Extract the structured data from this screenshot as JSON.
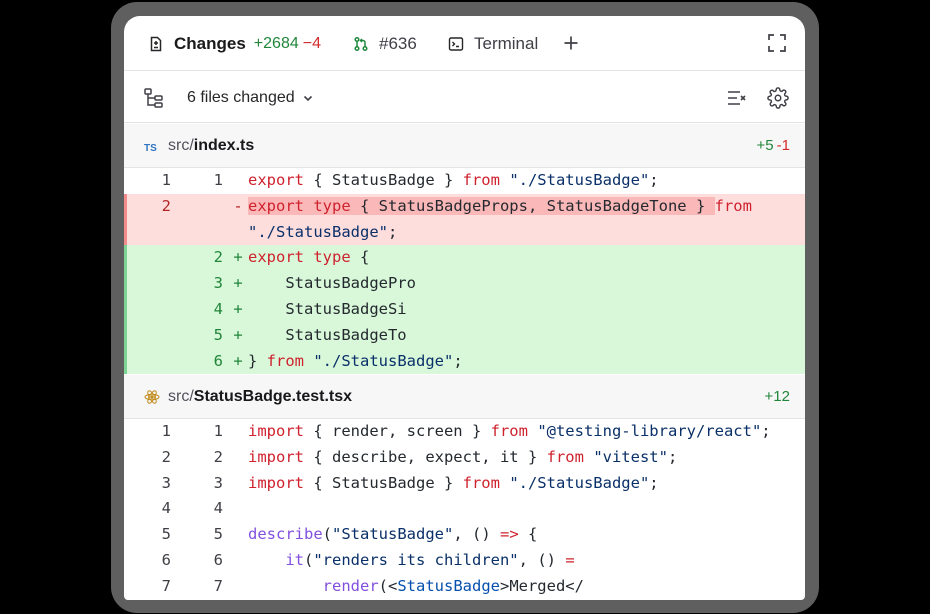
{
  "top_bar": {
    "changes_label": "Changes",
    "changes_additions": "+2684",
    "changes_deletions": "−4",
    "pr_label": "#636",
    "terminal_label": "Terminal",
    "icons": [
      "file-diff-icon",
      "pull-request-icon",
      "terminal-icon",
      "plus-icon",
      "expand-icon"
    ]
  },
  "toolbar": {
    "files_changed_label": "6 files changed",
    "icons": [
      "file-tree-icon",
      "chevron-down-icon",
      "collapse-all-icon",
      "gear-icon"
    ]
  },
  "files": [
    {
      "type_badge": "TS",
      "path_dir": "src/",
      "path_name": "index.ts",
      "additions": "+5",
      "deletions": "-1",
      "lines": [
        {
          "old": "1",
          "new": "1",
          "marker": "",
          "kind": "ctx",
          "code": [
            [
              "kw",
              "export"
            ],
            [
              "",
              " { StatusBadge } "
            ],
            [
              "kw",
              "from"
            ],
            [
              "",
              " "
            ],
            [
              "str",
              "\"./StatusBadge\""
            ],
            [
              "",
              ";"
            ]
          ]
        },
        {
          "old": "2",
          "new": "",
          "marker": "-",
          "kind": "del",
          "code": [
            [
              "kw hl",
              "export"
            ],
            [
              "hl",
              " "
            ],
            [
              "kw hl",
              "type"
            ],
            [
              "hl",
              " { StatusBadgeProps, StatusBadgeTone } "
            ],
            [
              "kw",
              "from"
            ]
          ]
        },
        {
          "old": "",
          "new": "",
          "marker": "",
          "kind": "del",
          "code": [
            [
              "str",
              "\"./StatusBadge\""
            ],
            [
              "",
              ";"
            ]
          ]
        },
        {
          "old": "",
          "new": "2",
          "marker": "+",
          "kind": "add",
          "code": [
            [
              "kw",
              "export"
            ],
            [
              "",
              " "
            ],
            [
              "kw",
              "type"
            ],
            [
              "",
              " {"
            ]
          ]
        },
        {
          "old": "",
          "new": "3",
          "marker": "+",
          "kind": "add",
          "code": [
            [
              "",
              "    StatusBadgePro"
            ]
          ]
        },
        {
          "old": "",
          "new": "4",
          "marker": "+",
          "kind": "add",
          "code": [
            [
              "",
              "    StatusBadgeSi"
            ]
          ]
        },
        {
          "old": "",
          "new": "5",
          "marker": "+",
          "kind": "add",
          "code": [
            [
              "",
              "    StatusBadgeTo"
            ]
          ]
        },
        {
          "old": "",
          "new": "6",
          "marker": "+",
          "kind": "add",
          "code": [
            [
              "",
              "} "
            ],
            [
              "kw",
              "from"
            ],
            [
              "",
              " "
            ],
            [
              "str",
              "\"./StatusBadge\""
            ],
            [
              "",
              ";"
            ]
          ]
        }
      ]
    },
    {
      "type_badge": "",
      "path_dir": "src/",
      "path_name": "StatusBadge.test.tsx",
      "additions": "+12",
      "deletions": "",
      "lines": [
        {
          "old": "1",
          "new": "1",
          "marker": "",
          "kind": "ctx",
          "code": [
            [
              "kw",
              "import"
            ],
            [
              "",
              " { render, screen } "
            ],
            [
              "kw",
              "from"
            ],
            [
              "",
              " "
            ],
            [
              "str",
              "\"@testing-library/react\""
            ],
            [
              "",
              ";"
            ]
          ]
        },
        {
          "old": "2",
          "new": "2",
          "marker": "",
          "kind": "ctx",
          "code": [
            [
              "kw",
              "import"
            ],
            [
              "",
              " { describe, expect, it } "
            ],
            [
              "kw",
              "from"
            ],
            [
              "",
              " "
            ],
            [
              "str",
              "\"vitest\""
            ],
            [
              "",
              ";"
            ]
          ]
        },
        {
          "old": "3",
          "new": "3",
          "marker": "",
          "kind": "ctx",
          "code": [
            [
              "kw",
              "import"
            ],
            [
              "",
              " { StatusBadge } "
            ],
            [
              "kw",
              "from"
            ],
            [
              "",
              " "
            ],
            [
              "str",
              "\"./StatusBadge\""
            ],
            [
              "",
              ";"
            ]
          ]
        },
        {
          "old": "4",
          "new": "4",
          "marker": "",
          "kind": "ctx",
          "code": []
        },
        {
          "old": "5",
          "new": "5",
          "marker": "",
          "kind": "ctx",
          "code": [
            [
              "fn",
              "describe"
            ],
            [
              "",
              "("
            ],
            [
              "str",
              "\"StatusBadge\""
            ],
            [
              "",
              ", () "
            ],
            [
              "kw",
              "=>"
            ],
            [
              "",
              " {"
            ]
          ]
        },
        {
          "old": "6",
          "new": "6",
          "marker": "",
          "kind": "ctx",
          "code": [
            [
              "",
              "    "
            ],
            [
              "fn",
              "it"
            ],
            [
              "",
              "("
            ],
            [
              "str",
              "\"renders its children\""
            ],
            [
              "",
              ", () "
            ],
            [
              "kw",
              "="
            ]
          ]
        },
        {
          "old": "7",
          "new": "7",
          "marker": "",
          "kind": "ctx",
          "code": [
            [
              "",
              "        "
            ],
            [
              "fn",
              "render"
            ],
            [
              "",
              "(<"
            ],
            [
              "cmp",
              "StatusBadge"
            ],
            [
              "",
              ">Merged</"
            ]
          ]
        }
      ]
    }
  ],
  "colors": {
    "addition": "#22863a",
    "deletion": "#d22c2c",
    "added_line_bg": "#d8f8d9",
    "removed_line_bg": "#fedddd",
    "keyword": "#cf222e",
    "string": "#0a3069",
    "function": "#8250df"
  }
}
